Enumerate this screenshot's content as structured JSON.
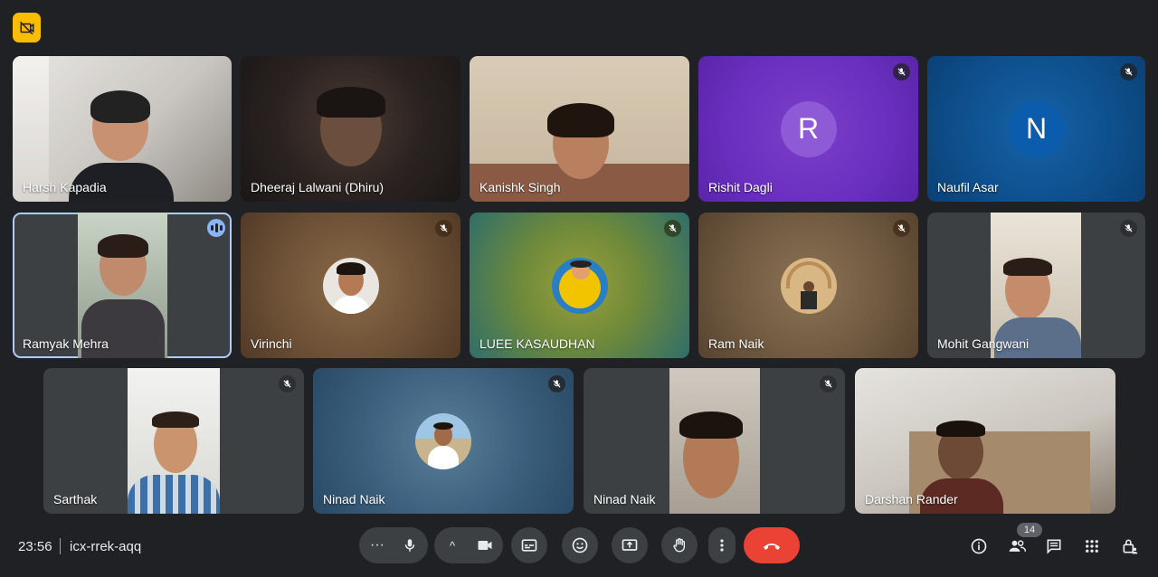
{
  "meeting": {
    "time": "23:56",
    "code": "icx-rrek-aqq",
    "participant_count": "14"
  },
  "participants": [
    {
      "name": "Harsh Kapadia"
    },
    {
      "name": "Dheeraj Lalwani (Dhiru)"
    },
    {
      "name": "Kanishk Singh"
    },
    {
      "name": "Rishit Dagli",
      "initial": "R"
    },
    {
      "name": "Naufil Asar",
      "initial": "N"
    },
    {
      "name": "Ramyak Mehra"
    },
    {
      "name": "Virinchi"
    },
    {
      "name": "LUEE KASAUDHAN"
    },
    {
      "name": "Ram Naik"
    },
    {
      "name": "Mohit Gangwani"
    },
    {
      "name": "Sarthak"
    },
    {
      "name": "Ninad Naik"
    },
    {
      "name": "Ninad Naik"
    },
    {
      "name": "Darshan Rander"
    }
  ],
  "controls": {
    "more_glyph": "···",
    "chevron_glyph": "^"
  },
  "colors": {
    "background": "#202124",
    "end_call": "#ea4335",
    "accent_badge": "#fbbc04",
    "speaking": "#8ab4f8"
  }
}
